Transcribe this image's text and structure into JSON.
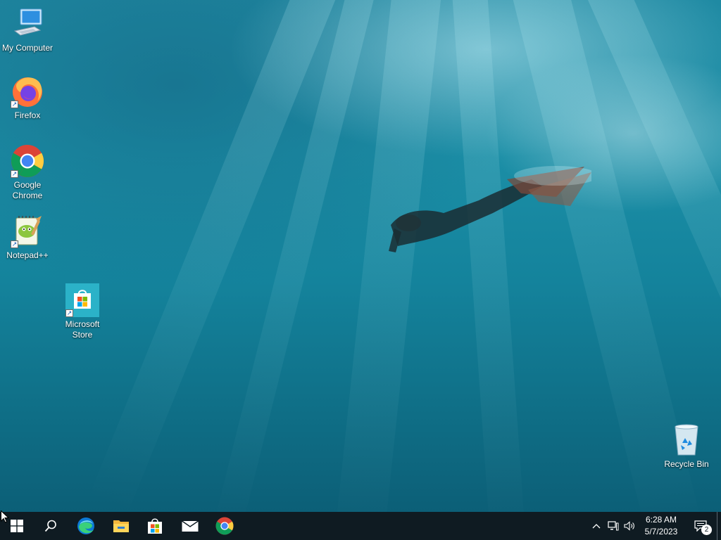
{
  "desktop": {
    "wallpaper": "underwater-freediver",
    "icons": [
      {
        "label": "My Computer",
        "icon": "computer-icon"
      },
      {
        "label": "Firefox",
        "icon": "firefox-icon"
      },
      {
        "label": "Google Chrome",
        "icon": "chrome-icon"
      },
      {
        "label": "Notepad++",
        "icon": "notepadpp-icon"
      },
      {
        "label": "Microsoft Store",
        "icon": "store-icon"
      },
      {
        "label": "Recycle Bin",
        "icon": "recycle-bin-icon"
      }
    ]
  },
  "taskbar": {
    "pinned": [
      "start-icon",
      "search-icon",
      "edge-icon",
      "file-explorer-icon",
      "store-icon",
      "mail-icon",
      "chrome-icon"
    ],
    "tray_icons": [
      "chevron-up-icon",
      "network-icon",
      "volume-icon"
    ],
    "clock": {
      "time": "6:28 AM",
      "date": "5/7/2023"
    },
    "notifications": {
      "count": "2"
    }
  },
  "colors": {
    "taskbar": "#0f1b22",
    "water": "#1b8ea6",
    "accent": "#00a4ef"
  }
}
